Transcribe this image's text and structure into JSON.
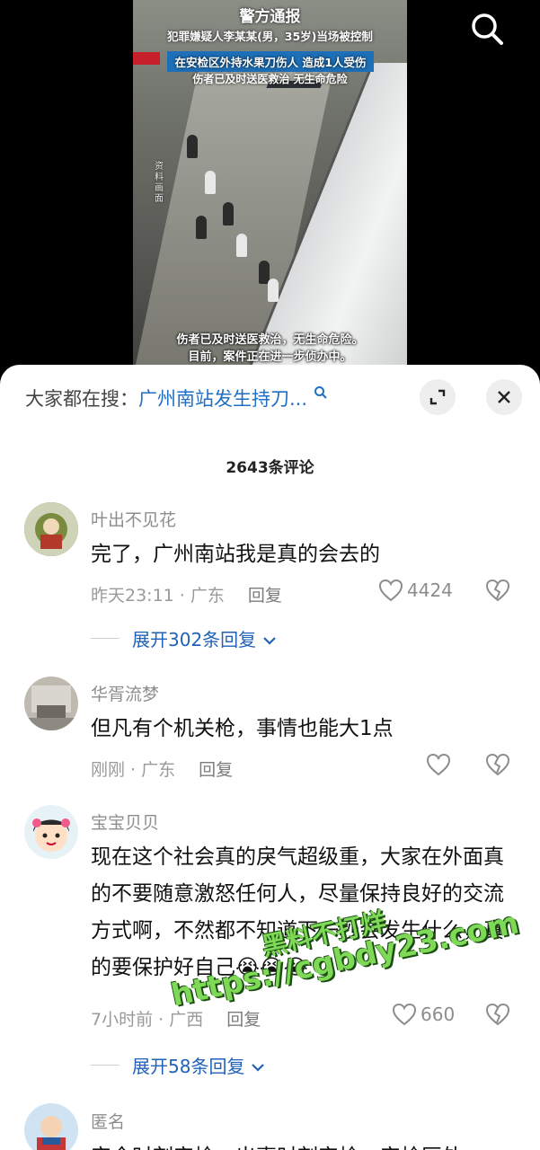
{
  "video": {
    "headline": "警方通报",
    "line1": "犯罪嫌疑人李某某(男，35岁)当场被控制",
    "line2": "在安检区外持水果刀伤人 造成1人受伤",
    "line3": "伤者已及时送医救治 无生命危险",
    "side_label": "资料画面",
    "subtitle1": "伤者已及时送医救治，无生命危险。",
    "subtitle2": "目前，案件正在进一步侦办中。"
  },
  "search_bar": {
    "prefix": "大家都在搜：",
    "query": "广州南站发生持刀...",
    "expand_icon": "expand-icon",
    "close_icon": "close-icon"
  },
  "comment_count": "2643条评论",
  "comments": [
    {
      "user": "叶出不见花",
      "text": "完了，广州南站我是真的会去的",
      "time_loc": "昨天23:11 · 广东",
      "reply": "回复",
      "likes": "4424",
      "expand": "展开302条回复"
    },
    {
      "user": "华胥流梦",
      "text": "但凡有个机关枪，事情也能大1点",
      "time_loc": "刚刚 · 广东",
      "reply": "回复",
      "likes": ""
    },
    {
      "user": "宝宝贝贝",
      "text": "现在这个社会真的戾气超级重，大家在外面真的不要随意激怒任何人，尽量保持良好的交流方式啊，不然都不知道下一秒会发生什么，真的要保护好自己😭😭😭",
      "time_loc": "7小时前 · 广西",
      "reply": "回复",
      "likes": "660",
      "expand": "展开58条回复"
    },
    {
      "user": "匿名",
      "text": "安全时刻安检，出事时刻安检，安检区外..."
    }
  ],
  "watermark": {
    "line1": "黑料不打烊",
    "line2": "https://cgbdy23.com"
  },
  "colors": {
    "link_blue": "#2162b8",
    "watermark_green": "#7ed957"
  }
}
